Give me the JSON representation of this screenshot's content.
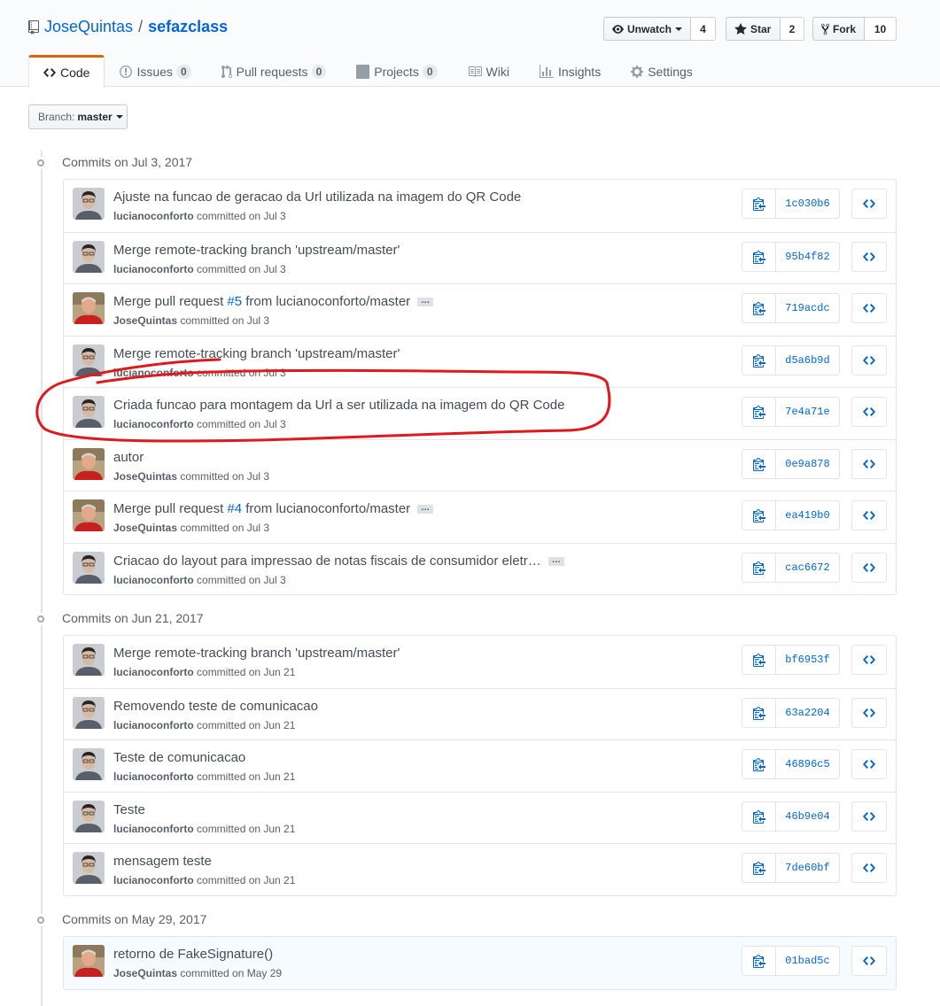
{
  "repo": {
    "owner": "JoseQuintas",
    "separator": "/",
    "name": "sefazclass"
  },
  "actions": {
    "watch": {
      "label": "Unwatch",
      "count": "4"
    },
    "star": {
      "label": "Star",
      "count": "2"
    },
    "fork": {
      "label": "Fork",
      "count": "10"
    }
  },
  "nav": [
    {
      "label": "Code",
      "icon": "code-icon",
      "count": null
    },
    {
      "label": "Issues",
      "icon": "issue-icon",
      "count": "0"
    },
    {
      "label": "Pull requests",
      "icon": "pull-request-icon",
      "count": "0"
    },
    {
      "label": "Projects",
      "icon": "project-icon",
      "count": "0"
    },
    {
      "label": "Wiki",
      "icon": "book-icon",
      "count": null
    },
    {
      "label": "Insights",
      "icon": "graph-icon",
      "count": null
    },
    {
      "label": "Settings",
      "icon": "gear-icon",
      "count": null
    }
  ],
  "branch": {
    "label": "Branch:",
    "value": "master"
  },
  "groups": [
    {
      "title": "Commits on Jul 3, 2017",
      "commits": [
        {
          "message": "Ajuste na funcao de geracao da Url utilizada na imagem do QR Code",
          "author": "lucianoconforto",
          "date_text": "committed on Jul 3",
          "sha": "1c030b6",
          "avatar": "luciano"
        },
        {
          "message": "Merge remote-tracking branch 'upstream/master'",
          "author": "lucianoconforto",
          "date_text": "committed on Jul 3",
          "sha": "95b4f82",
          "avatar": "luciano"
        },
        {
          "message_pre": "Merge pull request ",
          "message_link": "#5",
          "message_post": " from lucianoconforto/master",
          "has_more": true,
          "author": "JoseQuintas",
          "date_text": "committed on Jul 3",
          "sha": "719acdc",
          "avatar": "jose"
        },
        {
          "message": "Merge remote-tracking branch 'upstream/master'",
          "author": "lucianoconforto",
          "date_text": "committed on Jul 3",
          "sha": "d5a6b9d",
          "avatar": "luciano"
        },
        {
          "message": "Criada funcao para montagem da Url a ser utilizada na imagem do QR Code",
          "author": "lucianoconforto",
          "date_text": "committed on Jul 3",
          "sha": "7e4a71e",
          "avatar": "luciano",
          "circled": true
        },
        {
          "message": "autor",
          "author": "JoseQuintas",
          "date_text": "committed on Jul 3",
          "sha": "0e9a878",
          "avatar": "jose"
        },
        {
          "message_pre": "Merge pull request ",
          "message_link": "#4",
          "message_post": " from lucianoconforto/master",
          "has_more": true,
          "author": "JoseQuintas",
          "date_text": "committed on Jul 3",
          "sha": "ea419b0",
          "avatar": "jose"
        },
        {
          "message": "Criacao do layout para impressao de notas fiscais de consumidor eletr…",
          "has_more": true,
          "author": "lucianoconforto",
          "date_text": "committed on Jul 3",
          "sha": "cac6672",
          "avatar": "luciano"
        }
      ]
    },
    {
      "title": "Commits on Jun 21, 2017",
      "commits": [
        {
          "message": "Merge remote-tracking branch 'upstream/master'",
          "author": "lucianoconforto",
          "date_text": "committed on Jun 21",
          "sha": "bf6953f",
          "avatar": "luciano"
        },
        {
          "message": "Removendo teste de comunicacao",
          "author": "lucianoconforto",
          "date_text": "committed on Jun 21",
          "sha": "63a2204",
          "avatar": "luciano"
        },
        {
          "message": "Teste de comunicacao",
          "author": "lucianoconforto",
          "date_text": "committed on Jun 21",
          "sha": "46896c5",
          "avatar": "luciano"
        },
        {
          "message": "Teste",
          "author": "lucianoconforto",
          "date_text": "committed on Jun 21",
          "sha": "46b9e04",
          "avatar": "luciano"
        },
        {
          "message": "mensagem teste",
          "author": "lucianoconforto",
          "date_text": "committed on Jun 21",
          "sha": "7de60bf",
          "avatar": "luciano"
        }
      ]
    },
    {
      "title": "Commits on May 29, 2017",
      "commits": [
        {
          "message": "retorno de FakeSignature()",
          "author": "JoseQuintas",
          "date_text": "committed on May 29",
          "sha": "01bad5c",
          "avatar": "jose",
          "highlight": true
        }
      ]
    }
  ],
  "ellipsis_text": "…",
  "colors": {
    "link": "#0366d6",
    "accent_tab": "#e36209",
    "annotation": "#e0191f"
  }
}
